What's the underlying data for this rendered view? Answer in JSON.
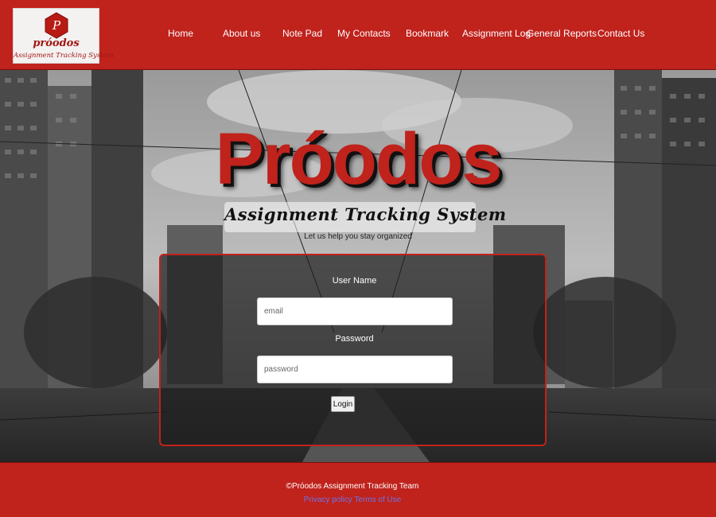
{
  "logo": {
    "brand": "próodos",
    "subtitle": "Assignment Tracking System"
  },
  "nav": {
    "home": "Home",
    "about": "About us",
    "notepad": "Note Pad",
    "contacts": "My Contacts",
    "bookmark": "Bookmark",
    "assignment_log": "Assignment Log",
    "reports": "General Reports",
    "contact_us": "Contact Us"
  },
  "hero": {
    "title": "Próodos",
    "subtitle": "Assignment Tracking System",
    "tagline": "Let us help you stay organized"
  },
  "login": {
    "username_label": "User Name",
    "username_placeholder": "email",
    "password_label": "Password",
    "password_placeholder": "password",
    "button": "Login"
  },
  "footer": {
    "copyright": "©Próodos Assignment Tracking Team",
    "privacy": "Privacy policy",
    "terms": "Terms of Use"
  },
  "colors": {
    "brand_red": "#c0221c",
    "link_blue": "#6a76e6"
  }
}
